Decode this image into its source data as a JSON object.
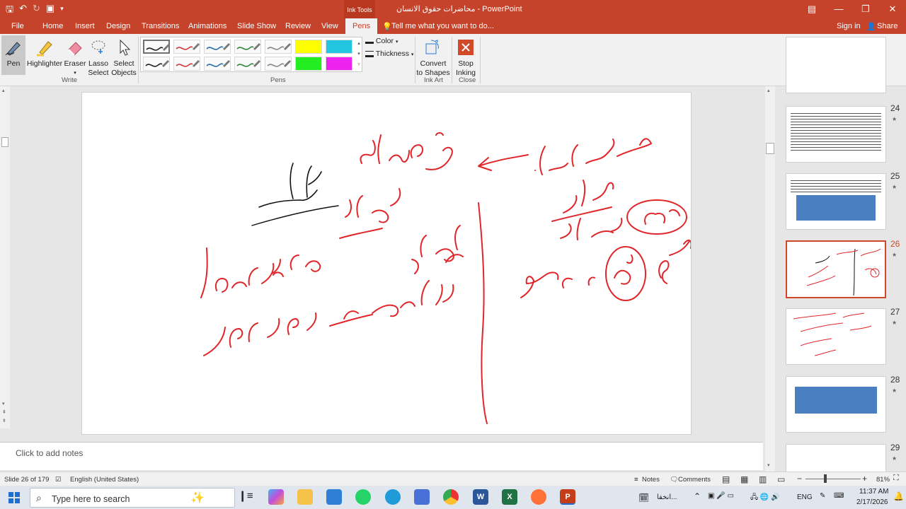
{
  "window": {
    "title": "محاضرات حقوق الانسان  -  PowerPoint",
    "context_tag": "Ink Tools",
    "sign_in": "Sign in",
    "share": "Share"
  },
  "tabs": [
    "File",
    "Home",
    "Insert",
    "Design",
    "Transitions",
    "Animations",
    "Slide Show",
    "Review",
    "View",
    "Pens"
  ],
  "active_tab": "Pens",
  "tell_me": "Tell me what you want to do...",
  "ribbon": {
    "write": {
      "pen": "Pen",
      "highlighter": "Highlighter",
      "eraser": "Eraser",
      "lasso_1": "Lasso",
      "lasso_2": "Select",
      "select_1": "Select",
      "select_2": "Objects",
      "group": "Write"
    },
    "pens": {
      "color": "Color",
      "thickness": "Thickness",
      "group": "Pens"
    },
    "ink_art": {
      "convert_1": "Convert",
      "convert_2": "to Shapes",
      "group": "Ink Art"
    },
    "close": {
      "stop_1": "Stop",
      "stop_2": "Inking",
      "group": "Close"
    }
  },
  "pen_colors": [
    "#222222",
    "#d33b3b",
    "#2d6fa8",
    "#2f8a3c",
    "#888888",
    "#ffff00",
    "#22c6e0",
    "#222222",
    "#d33b3b",
    "#2d6fa8",
    "#2f8a3c",
    "#888888",
    "#22ee22",
    "#ee22ee"
  ],
  "accent": "#c4432a",
  "ink_color": "#e0262a",
  "notes_placeholder": "Click to add notes",
  "thumbnails": [
    {
      "num": "24"
    },
    {
      "num": "25"
    },
    {
      "num": "26"
    },
    {
      "num": "27"
    },
    {
      "num": "28"
    },
    {
      "num": "29"
    }
  ],
  "status": {
    "slide": "Slide 26 of 179",
    "language": "English (United States)",
    "notes": "Notes",
    "comments": "Comments",
    "zoom": "81%"
  },
  "taskbar": {
    "search_placeholder": "Type here to search",
    "time": "11:37 AM",
    "date": "2/17/2026",
    "lang": "ENG",
    "news": "انخفا..."
  }
}
